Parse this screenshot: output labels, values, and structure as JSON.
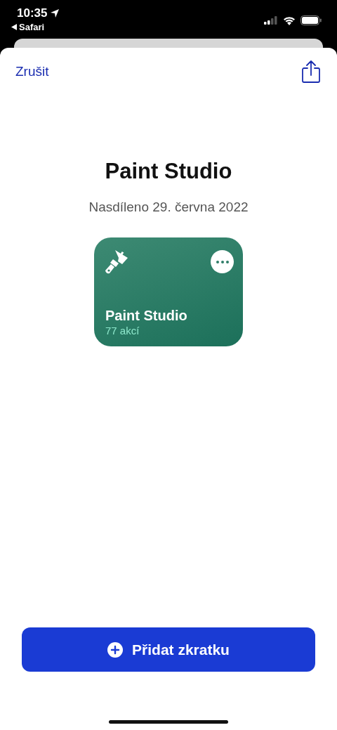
{
  "status_bar": {
    "time": "10:35",
    "back_label": "Safari"
  },
  "nav": {
    "cancel": "Zrušit"
  },
  "title": "Paint Studio",
  "subtitle": "Nasdíleno 29. června 2022",
  "shortcut_card": {
    "name": "Paint Studio",
    "count": "77 akcí"
  },
  "add_button": {
    "label": "Přidat zkratku"
  }
}
